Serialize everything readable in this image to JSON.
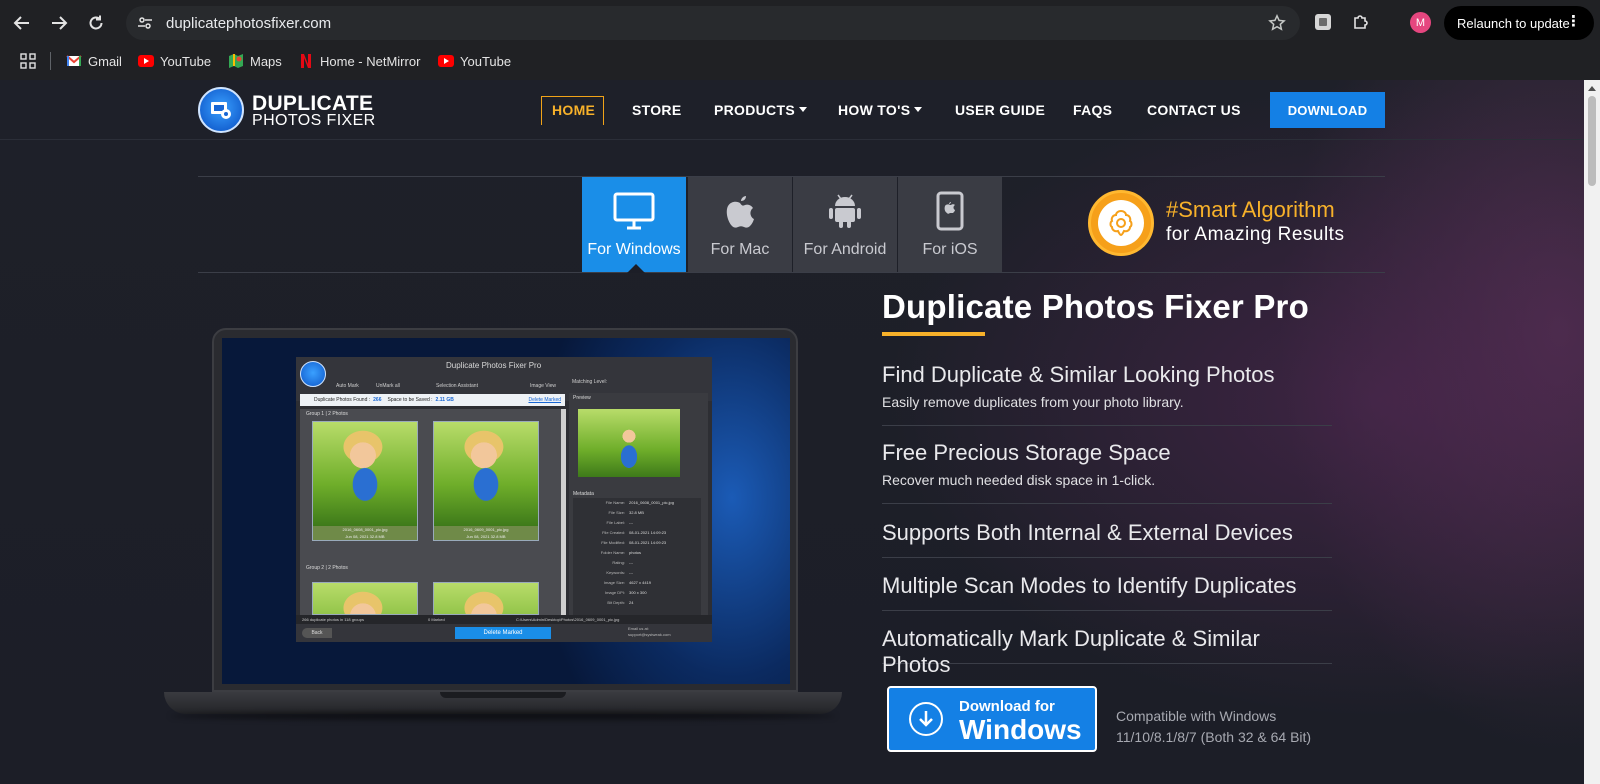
{
  "browser": {
    "url": "duplicatephotosfixer.com",
    "relaunch_label": "Relaunch to update",
    "profile_initial": "M",
    "bookmarks": [
      {
        "label": "Gmail",
        "icon": "gmail-icon"
      },
      {
        "label": "YouTube",
        "icon": "youtube-icon"
      },
      {
        "label": "Maps",
        "icon": "maps-icon"
      },
      {
        "label": "Home - NetMirror",
        "icon": "netflix-icon"
      },
      {
        "label": "YouTube",
        "icon": "youtube-icon"
      }
    ]
  },
  "site": {
    "logo_title": "DUPLICATE",
    "logo_subtitle": "PHOTOS FIXER",
    "menu": {
      "home": "HOME",
      "store": "STORE",
      "products": "PRODUCTS",
      "howtos": "HOW TO'S",
      "guide": "USER GUIDE",
      "faqs": "FAQS",
      "contact": "CONTACT US"
    },
    "download": "DOWNLOAD",
    "accent": "#1480e5",
    "highlight": "#f7b12a"
  },
  "platforms": [
    {
      "label": "For Windows",
      "icon": "monitor-icon"
    },
    {
      "label": "For Mac",
      "icon": "apple-icon"
    },
    {
      "label": "For Android",
      "icon": "android-icon"
    },
    {
      "label": "For iOS",
      "icon": "ios-device-icon"
    }
  ],
  "smart": {
    "line1": "#Smart Algorithm",
    "line2": "for Amazing Results"
  },
  "app": {
    "title": "Duplicate Photos Fixer Pro",
    "tools": [
      "Auto Mark",
      "UnMark all",
      "Selection Assistant",
      "Image View",
      "Matching Level:"
    ],
    "found_label": "Duplicate Photos Found :",
    "found_value": "266",
    "space_label": "Space to be Saved :",
    "space_value": "2.11 GB",
    "delete_marked_link": "Delete Marked",
    "group1": "Group 1 |  2  Photos",
    "group2": "Group 2 |  2  Photos",
    "thumb1_name": "2016_0608_0001_pic.jpg",
    "thumb1_meta": "Jun 08, 2021     32.8 MB",
    "thumb2_name": "2016_0609_0001_pic.jpg",
    "thumb2_meta": "Jun 08, 2021     32.8 MB",
    "preview_label": "Preview",
    "metadata_label": "Metadata",
    "metadata": [
      {
        "k": "File Name:",
        "v": "2016_0608_0001_pic.jpg"
      },
      {
        "k": "File Size:",
        "v": "32.8 MB"
      },
      {
        "k": "File Label:",
        "v": "---"
      },
      {
        "k": "File Created:",
        "v": "08-01-2021 14:09:23"
      },
      {
        "k": "File Modified:",
        "v": "08-01-2021 14:09:23"
      },
      {
        "k": "Folder Name:",
        "v": "photos"
      },
      {
        "k": "Rating:",
        "v": "---"
      },
      {
        "k": "Keywords:",
        "v": "---"
      },
      {
        "k": "Image Size:",
        "v": "4627 x 4419"
      },
      {
        "k": "Image DPI:",
        "v": "300 x 300"
      },
      {
        "k": "Bit Depth:",
        "v": "24"
      }
    ],
    "status_left": "266 duplicate photos in 118 groups",
    "status_mid": "0 Marked",
    "status_path": "C:\\Users\\Admin\\Desktop\\Photos\\2016_0609_0001_pic.jpg",
    "back": "Back",
    "delete_button": "Delete Marked",
    "email_line1": "Email us at:",
    "email_line2": "support@systweak.com"
  },
  "product": {
    "title": "Duplicate Photos Fixer Pro",
    "features": [
      {
        "heading": "Find Duplicate & Similar Looking Photos",
        "sub": "Easily remove duplicates from your photo library."
      },
      {
        "heading": "Free Precious Storage Space",
        "sub": "Recover much needed disk space in 1-click."
      },
      {
        "heading": "Supports Both Internal & External Devices",
        "sub": ""
      },
      {
        "heading": "Multiple Scan Modes to Identify Duplicates",
        "sub": ""
      },
      {
        "heading": "Automatically Mark Duplicate & Similar Photos",
        "sub": ""
      }
    ],
    "win_btn_line1": "Download for",
    "win_btn_line2": "Windows",
    "compat_line1": "Compatible with Windows",
    "compat_line2": "11/10/8.1/8/7 (Both 32 & 64 Bit)"
  }
}
